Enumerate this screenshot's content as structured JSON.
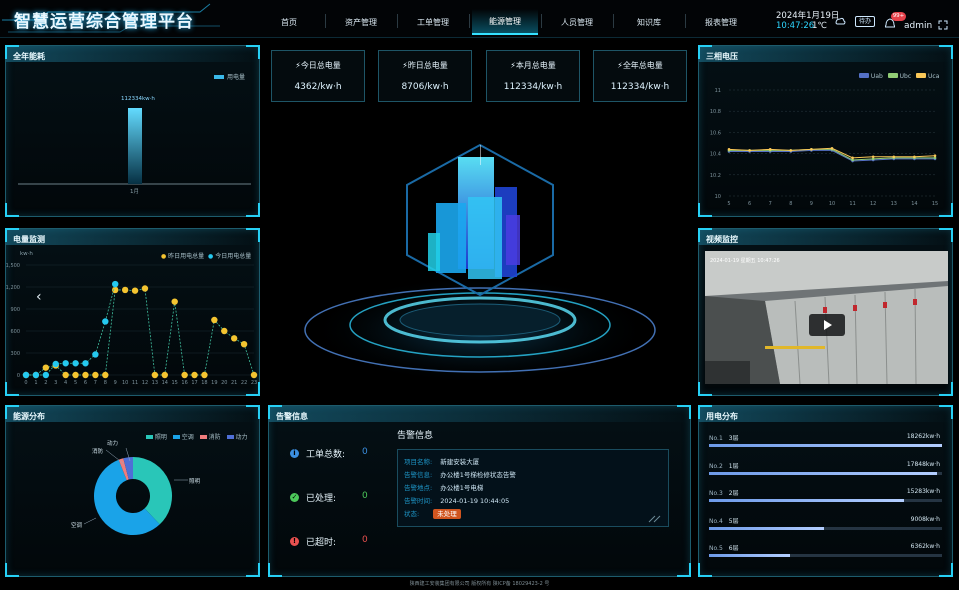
{
  "header": {
    "title": "智慧运营综合管理平台",
    "date": "2024年1月19日",
    "time": "10:47:26",
    "temp": "1℃",
    "todo_label": "待办",
    "badge": "99+",
    "user": "admin",
    "nav": [
      "首页",
      "资产管理",
      "工单管理",
      "能源管理",
      "人员管理",
      "知识库",
      "报表管理"
    ],
    "active_nav": 3
  },
  "kpis": [
    {
      "title": "今日总电量",
      "value": "4362/kw·h"
    },
    {
      "title": "昨日总电量",
      "value": "8706/kw·h"
    },
    {
      "title": "本月总电量",
      "value": "112334/kw·h"
    },
    {
      "title": "全年总电量",
      "value": "112334/kw·h"
    }
  ],
  "annual": {
    "title": "全年能耗",
    "legend": "用电量",
    "bar_label": "112334kw·h",
    "x_label": "1月"
  },
  "forecast": {
    "title": "电量监测",
    "unit": "kw·h",
    "legend": [
      "昨日用电总量",
      "今日用电总量"
    ],
    "y_ticks": [
      "1,500",
      "1,200",
      "900",
      "600",
      "300",
      "0"
    ],
    "x_ticks": [
      "0",
      "1",
      "2",
      "3",
      "4",
      "5",
      "6",
      "7",
      "8",
      "9",
      "10",
      "11",
      "12",
      "13",
      "14",
      "15",
      "16",
      "17",
      "18",
      "19",
      "20",
      "21",
      "22",
      "23"
    ]
  },
  "energy_dist": {
    "title": "能源分布",
    "legend": [
      "照明",
      "空调",
      "消防",
      "动力"
    ],
    "labels": {
      "a": "动力",
      "b": "消防",
      "c": "照明",
      "d": "空调"
    }
  },
  "alarm": {
    "title": "告警信息",
    "stats": [
      {
        "label": "工单总数:",
        "value": "0"
      },
      {
        "label": "已处理:",
        "value": "0"
      },
      {
        "label": "已超时:",
        "value": "0"
      }
    ],
    "detail_title": "告警信息",
    "rows": [
      {
        "k": "项目名称:",
        "v": "新建安装大厦"
      },
      {
        "k": "告警信息:",
        "v": "办公楼1号梯检修状态告警"
      },
      {
        "k": "告警地点:",
        "v": "办公楼1号电梯"
      },
      {
        "k": "告警时间:",
        "v": "2024-01-19 10:44:05"
      },
      {
        "k": "状态:",
        "v": "未处理"
      }
    ]
  },
  "voltage": {
    "title": "三相电压",
    "legend": [
      "Uab",
      "Ubc",
      "Uca"
    ],
    "y_ticks": [
      "11",
      "10.8",
      "10.6",
      "10.4",
      "10.2",
      "10"
    ],
    "x_ticks": [
      "5",
      "6",
      "7",
      "8",
      "9",
      "10",
      "11",
      "12",
      "13",
      "14",
      "15"
    ]
  },
  "video": {
    "title": "视频监控",
    "overlay": "2024-01-19  星期五  10:47:26"
  },
  "usage": {
    "title": "用电分布",
    "items": [
      {
        "rank": "No.1",
        "name": "3层",
        "value": "18262kw·h",
        "pct": 1.0
      },
      {
        "rank": "No.2",
        "name": "1层",
        "value": "17848kw·h",
        "pct": 0.977
      },
      {
        "rank": "No.3",
        "name": "2层",
        "value": "15283kw·h",
        "pct": 0.837
      },
      {
        "rank": "No.4",
        "name": "5层",
        "value": "9008kw·h",
        "pct": 0.493
      },
      {
        "rank": "No.5",
        "name": "6层",
        "value": "6362kw·h",
        "pct": 0.348
      }
    ]
  },
  "footer": "陕西建工安装集团有限公司 版权所有 陕ICP备 18029423-2 号",
  "chart_data": [
    {
      "type": "bar",
      "title": "全年能耗",
      "categories": [
        "1月"
      ],
      "series": [
        {
          "name": "用电量",
          "values": [
            112334
          ]
        }
      ]
    },
    {
      "type": "line",
      "title": "电量监测",
      "x": [
        0,
        1,
        2,
        3,
        4,
        5,
        6,
        7,
        8,
        9,
        10,
        11,
        12,
        13,
        14,
        15,
        16,
        17,
        18,
        19,
        20,
        21,
        22,
        23
      ],
      "ylim": [
        0,
        1500
      ],
      "series": [
        {
          "name": "昨日用电总量",
          "values": [
            0,
            0,
            100,
            130,
            0,
            0,
            0,
            0,
            0,
            1160,
            1160,
            1150,
            1180,
            0,
            0,
            1000,
            0,
            0,
            0,
            750,
            600,
            500,
            420,
            0
          ]
        },
        {
          "name": "今日用电总量",
          "values": [
            0,
            0,
            0,
            150,
            160,
            160,
            160,
            280,
            730,
            1240,
            null,
            null,
            null,
            null,
            null,
            null,
            null,
            null,
            null,
            null,
            null,
            null,
            null,
            null
          ]
        }
      ]
    },
    {
      "type": "pie",
      "title": "能源分布",
      "categories": [
        "照明",
        "空调",
        "消防",
        "动力"
      ],
      "values": [
        38,
        56,
        2,
        4
      ]
    },
    {
      "type": "line",
      "title": "三相电压",
      "x": [
        5,
        6,
        7,
        8,
        9,
        10,
        11,
        12,
        13,
        14,
        15
      ],
      "ylim": [
        10,
        11
      ],
      "series": [
        {
          "name": "Uab",
          "values": [
            10.42,
            10.42,
            10.42,
            10.42,
            10.43,
            10.43,
            10.33,
            10.34,
            10.35,
            10.35,
            10.35
          ]
        },
        {
          "name": "Ubc",
          "values": [
            10.43,
            10.43,
            10.43,
            10.43,
            10.44,
            10.44,
            10.34,
            10.35,
            10.36,
            10.36,
            10.36
          ]
        },
        {
          "name": "Uca",
          "values": [
            10.44,
            10.43,
            10.44,
            10.43,
            10.44,
            10.45,
            10.36,
            10.37,
            10.37,
            10.37,
            10.38
          ]
        }
      ]
    }
  ]
}
